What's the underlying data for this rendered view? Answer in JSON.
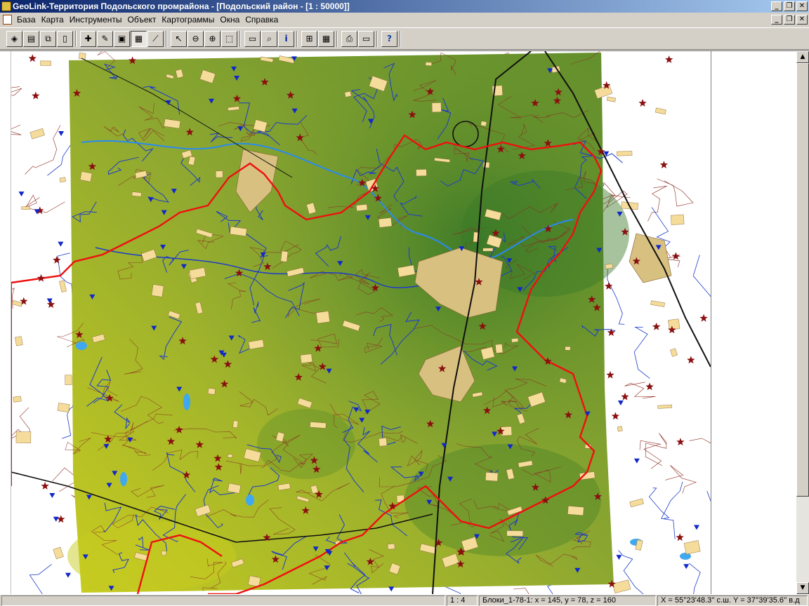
{
  "window": {
    "title": "GeoLink-Территория Подольского промрайона - [Подольский район - [1 : 50000]]",
    "min": "_",
    "max": "❐",
    "close": "✕"
  },
  "menu": [
    {
      "label": "База"
    },
    {
      "label": "Карта"
    },
    {
      "label": "Инструменты"
    },
    {
      "label": "Объект"
    },
    {
      "label": "Картограммы"
    },
    {
      "label": "Окна"
    },
    {
      "label": "Справка"
    }
  ],
  "toolbar": {
    "groups": [
      [
        "open-layer-icon",
        "layers-icon",
        "copy-layer-icon",
        "new-layer-icon"
      ],
      [
        "chart-icon",
        "edit-chart-icon",
        "save-icon",
        "table-chart-icon",
        "graph-icon"
      ],
      [
        "pointer-icon",
        "zoom-out-icon",
        "zoom-in-icon",
        "zoom-rect-icon"
      ],
      [
        "label-icon",
        "find-icon",
        "info-icon"
      ],
      [
        "add-window-icon",
        "grid-icon"
      ],
      [
        "print-icon",
        "export-icon"
      ],
      [
        "help-icon"
      ]
    ],
    "glyphs": {
      "open-layer-icon": "◈",
      "layers-icon": "▤",
      "copy-layer-icon": "⧉",
      "new-layer-icon": "▯",
      "chart-icon": "✚",
      "edit-chart-icon": "✎",
      "save-icon": "▣",
      "table-chart-icon": "▦",
      "graph-icon": "⟋",
      "pointer-icon": "↖",
      "zoom-out-icon": "⊖",
      "zoom-in-icon": "⊕",
      "zoom-rect-icon": "⬚",
      "label-icon": "▭",
      "find-icon": "⌕",
      "info-icon": "i",
      "add-window-icon": "⊞",
      "grid-icon": "▦",
      "print-icon": "⎙",
      "export-icon": "▭",
      "help-icon": "?"
    }
  },
  "status": {
    "scale": "1 : 4",
    "block": "Блоки_1-78-1: x = 145, y = 78, z = 160",
    "coords": "X = 55°23'48.3'' с.ш.  Y = 37°39'35.6'' в.д"
  },
  "scrollbar": {
    "up": "▲",
    "down": "▼"
  },
  "map": {
    "colors": {
      "relief_light": "#c8cc20",
      "relief_mid": "#8ea830",
      "relief_dark": "#3c7a28",
      "urban": "#f5dc9a",
      "urban_big": "#d8c080",
      "river": "#1e3cc8",
      "lake": "#40a8f0",
      "contour": "#8c2a20",
      "border": "#ee1010",
      "rail": "#101010",
      "star": "#8a1010",
      "tri": "#1028c8"
    }
  }
}
